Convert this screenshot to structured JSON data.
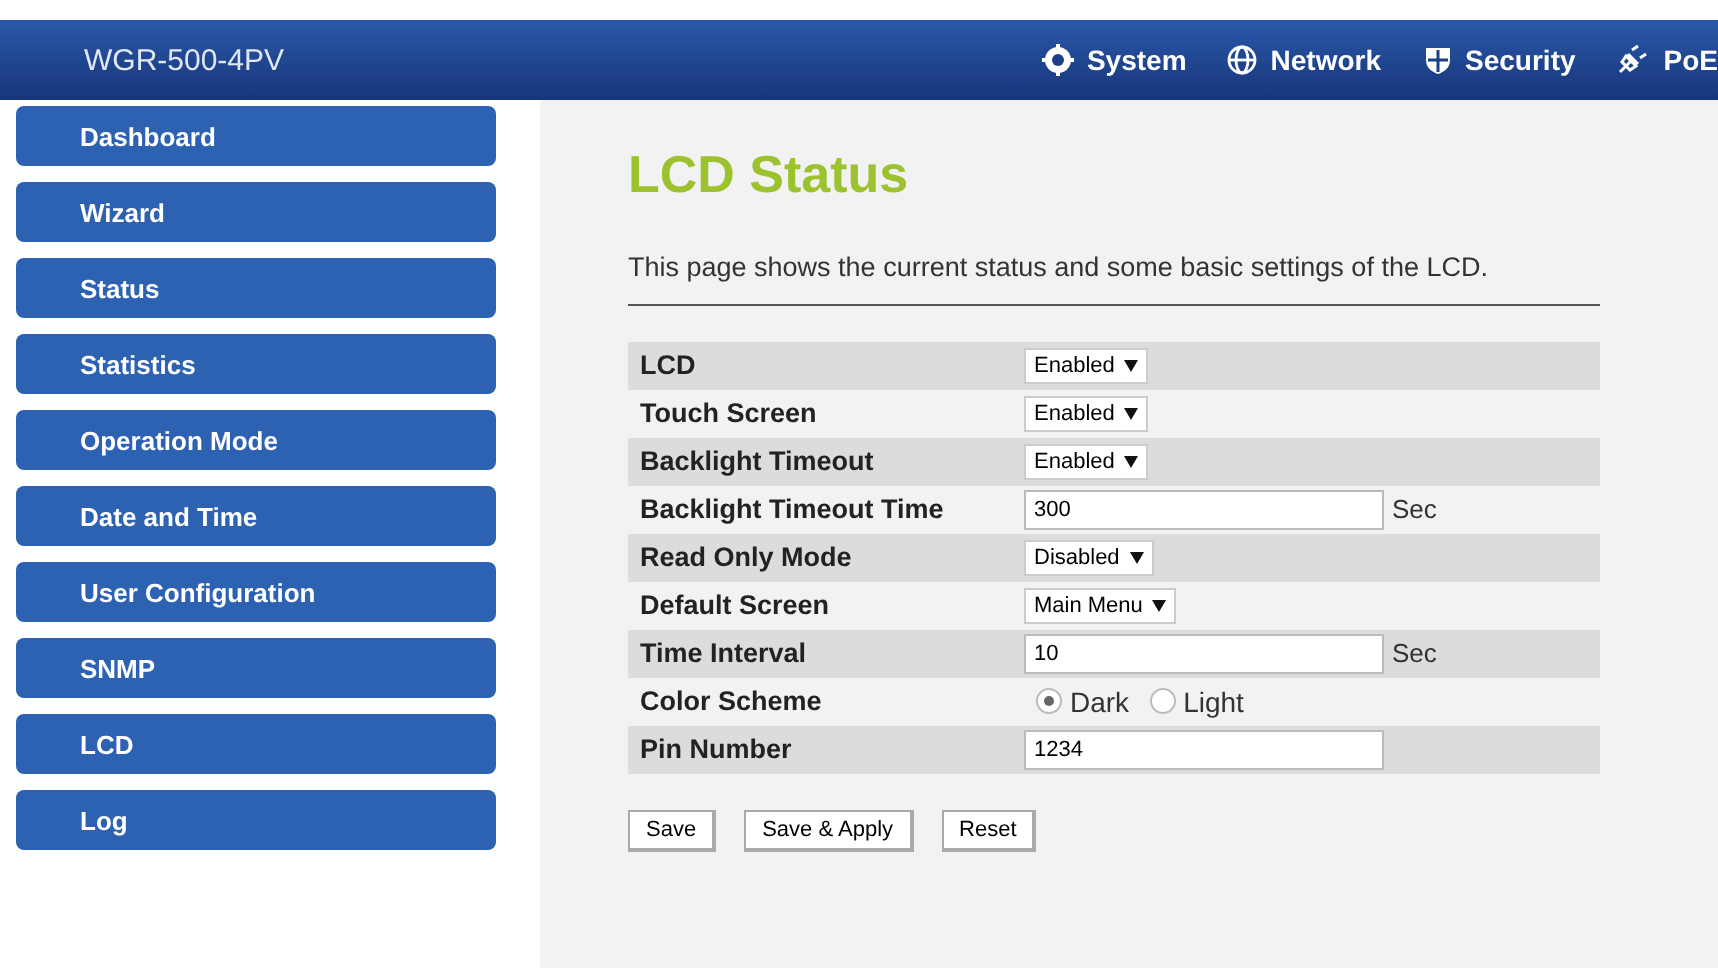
{
  "header": {
    "product": "WGR-500-4PV",
    "menu": [
      {
        "label": "System"
      },
      {
        "label": "Network"
      },
      {
        "label": "Security"
      },
      {
        "label": "PoE"
      }
    ]
  },
  "sidebar": {
    "items": [
      "Dashboard",
      "Wizard",
      "Status",
      "Statistics",
      "Operation Mode",
      "Date and Time",
      "User Configuration",
      "SNMP",
      "LCD",
      "Log"
    ]
  },
  "page": {
    "title": "LCD Status",
    "description": "This page shows the current status and some basic settings of the LCD."
  },
  "settings": [
    {
      "kind": "select",
      "label": "LCD",
      "value": "Enabled"
    },
    {
      "kind": "select",
      "label": "Touch Screen",
      "value": "Enabled"
    },
    {
      "kind": "select",
      "label": "Backlight Timeout",
      "value": "Enabled"
    },
    {
      "kind": "text",
      "label": "Backlight Timeout Time",
      "value": "300",
      "unit": "Sec"
    },
    {
      "kind": "select",
      "label": "Read Only Mode",
      "value": "Disabled"
    },
    {
      "kind": "select",
      "label": "Default Screen",
      "value": "Main Menu"
    },
    {
      "kind": "text",
      "label": "Time Interval",
      "value": "10",
      "unit": "Sec"
    },
    {
      "kind": "radio",
      "label": "Color Scheme",
      "options": [
        {
          "label": "Dark",
          "selected": true
        },
        {
          "label": "Light",
          "selected": false
        }
      ]
    },
    {
      "kind": "text",
      "label": "Pin Number",
      "value": "1234"
    }
  ],
  "buttons": [
    "Save",
    "Save & Apply",
    "Reset"
  ]
}
